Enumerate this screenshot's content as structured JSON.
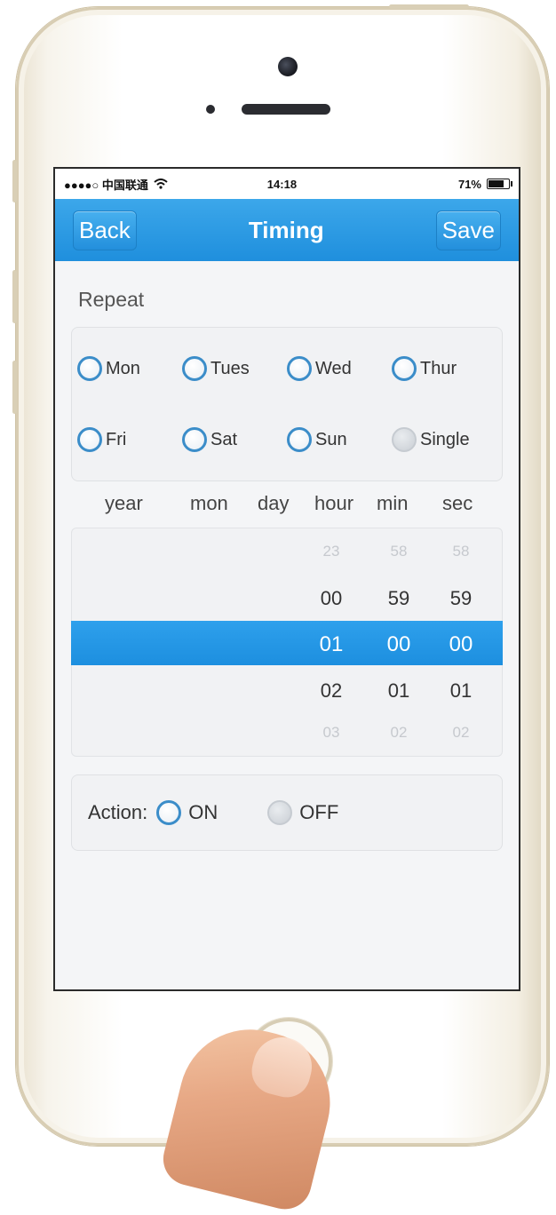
{
  "status": {
    "carrier": "●●●●○ 中国联通",
    "time": "14:18",
    "battery": "71%",
    "battery_fraction": 0.71
  },
  "navbar": {
    "back_label": "Back",
    "title": "Timing",
    "save_label": "Save"
  },
  "repeat": {
    "label": "Repeat",
    "days": [
      "Mon",
      "Tues",
      "Wed",
      "Thur",
      "Fri",
      "Sat",
      "Sun",
      "Single"
    ],
    "single_disabled": true
  },
  "picker": {
    "headers": [
      "year",
      "mon",
      "day",
      "hour",
      "min",
      "sec"
    ],
    "rows": [
      {
        "hour": "23",
        "min": "58",
        "sec": "58",
        "state": "faint"
      },
      {
        "hour": "00",
        "min": "59",
        "sec": "59",
        "state": "normal"
      },
      {
        "hour": "01",
        "min": "00",
        "sec": "00",
        "state": "selected"
      },
      {
        "hour": "02",
        "min": "01",
        "sec": "01",
        "state": "normal"
      },
      {
        "hour": "03",
        "min": "02",
        "sec": "02",
        "state": "faint"
      }
    ]
  },
  "action": {
    "label": "Action:",
    "on_label": "ON",
    "off_label": "OFF"
  },
  "colors": {
    "accent": "#2196e6",
    "radio_border": "#3b8dc9",
    "disabled": "#c6cbd1"
  }
}
